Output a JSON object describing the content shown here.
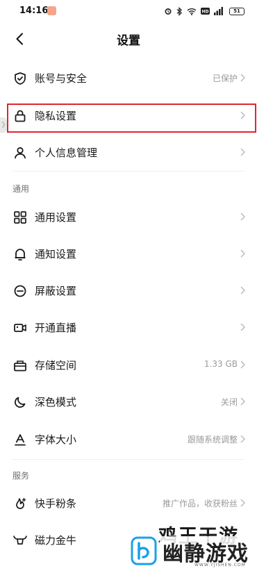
{
  "status_bar": {
    "time": "14:16",
    "battery": "51"
  },
  "header": {
    "title": "设置"
  },
  "account_group": [
    {
      "label": "账号与安全",
      "value": "已保护"
    },
    {
      "label": "隐私设置",
      "value": ""
    },
    {
      "label": "个人信息管理",
      "value": ""
    }
  ],
  "general": {
    "title": "通用",
    "items": [
      {
        "label": "通用设置",
        "value": ""
      },
      {
        "label": "通知设置",
        "value": ""
      },
      {
        "label": "屏蔽设置",
        "value": ""
      },
      {
        "label": "开通直播",
        "value": ""
      },
      {
        "label": "存储空间",
        "value": "1.33 GB"
      },
      {
        "label": "深色模式",
        "value": "关闭"
      },
      {
        "label": "字体大小",
        "value": "跟随系统调整"
      }
    ]
  },
  "services": {
    "title": "服务",
    "items": [
      {
        "label": "快手粉条",
        "value": "推广作品，收获粉丝"
      },
      {
        "label": "磁力金牛",
        "value": ""
      }
    ]
  },
  "watermark": {
    "main": "幽静游戏",
    "back": "鸡王干游",
    "url": "WWW.YJISHEN.COM"
  },
  "colors": {
    "highlight": "#e0242f",
    "chevron": "#b8b8b8",
    "secondary_text": "#9a9a9a"
  }
}
